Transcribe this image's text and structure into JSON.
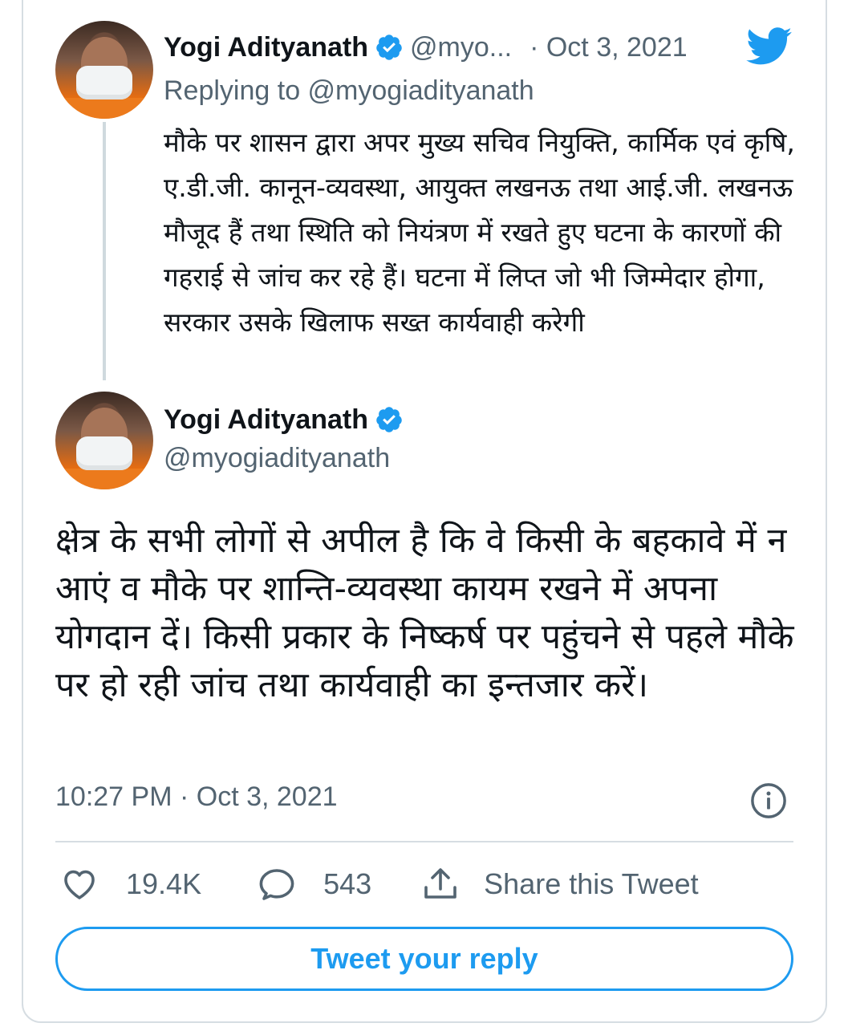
{
  "colors": {
    "accent": "#1d9bf0",
    "text": "#0f1419",
    "secondary": "#536471",
    "divider": "#d6dde2"
  },
  "parent_tweet": {
    "author_name": "Yogi Adityanath",
    "handle_truncated": "@myo...",
    "date": "· Oct 3, 2021",
    "replying_to": "Replying to @myogiadityanath",
    "text": "मौके पर शासन द्वारा अपर मुख्य सचिव नियुक्ति, कार्मिक एवं कृषि, ए.डी.जी. कानून-व्यवस्था, आयुक्त लखनऊ तथा आई.जी. लखनऊ मौजूद हैं तथा स्थिति को नियंत्रण में रखते हुए घटना के कारणों की गहराई से जांच कर रहे हैं। घटना में लिप्त जो भी जिम्मेदार होगा, सरकार उसके खिलाफ सख्त कार्यवाही करेगी",
    "avatar_icon": "profile-photo",
    "verified_icon": "verified-badge-icon",
    "platform_icon": "twitter-bird-icon"
  },
  "main_tweet": {
    "author_name": "Yogi Adityanath",
    "handle": "@myogiadityanath",
    "text": "क्षेत्र के सभी लोगों से अपील है कि वे किसी के बहकावे में न आएं व मौके पर शान्ति-व्यवस्था कायम रखने में अपना योगदान दें। किसी प्रकार के निष्कर्ष पर पहुंचने से पहले मौके पर हो रही जांच तथा कार्यवाही का इन्तजार करें।",
    "timestamp": "10:27 PM · Oct 3, 2021",
    "info_icon": "info-icon",
    "likes": "19.4K",
    "replies": "543",
    "share_label": "Share this Tweet",
    "reply_button_label": "Tweet your reply"
  }
}
